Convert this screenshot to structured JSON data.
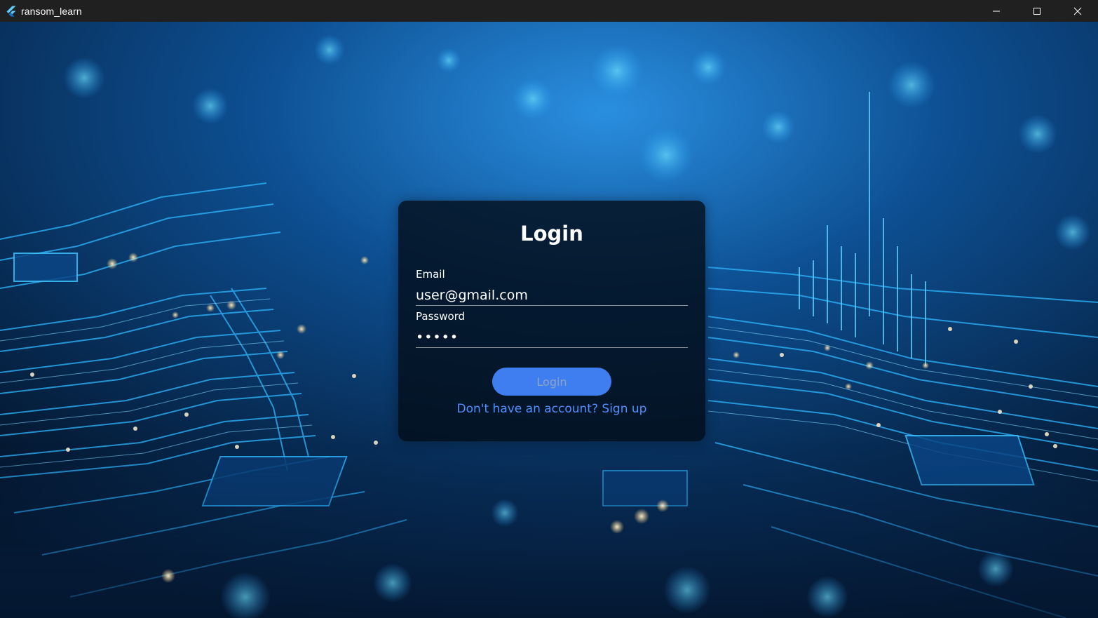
{
  "window": {
    "title": "ransom_learn",
    "app_icon": "flutter-logo-icon",
    "controls": [
      "minimize-icon",
      "maximize-icon",
      "close-icon"
    ]
  },
  "background": {
    "description_icon": "circuit-board-image",
    "colors": {
      "deep": "#041427",
      "mid": "#0b4f9a",
      "glow": "#2fb8ff"
    }
  },
  "login": {
    "title": "Login",
    "email_label": "Email",
    "email_value": "user@gmail.com",
    "password_label": "Password",
    "password_value": "•••••",
    "submit_label": "Login",
    "signup_link": "Don't have an account? Sign up"
  },
  "colors": {
    "accent": "#3f7ef0",
    "link": "#4f8fff",
    "card": "#030c18"
  }
}
